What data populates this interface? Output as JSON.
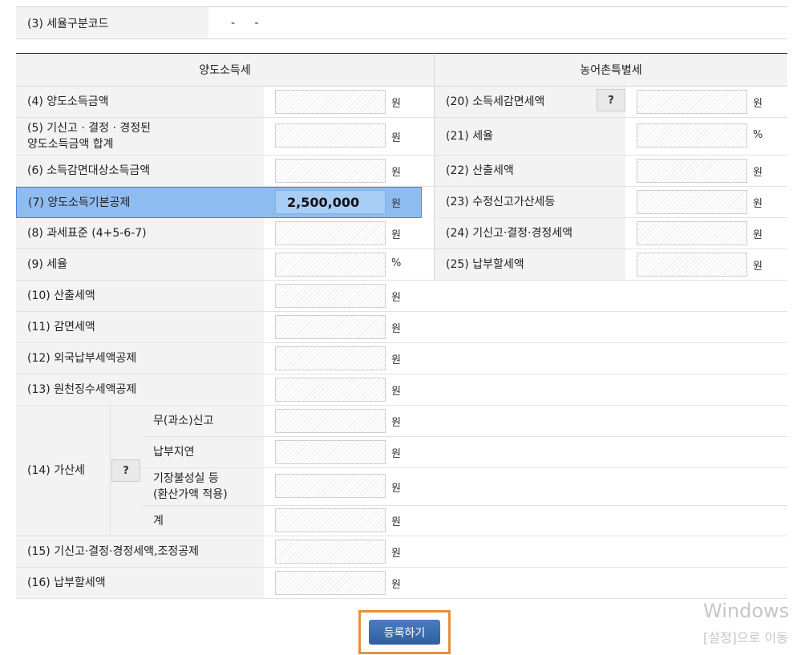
{
  "tax_code": {
    "label": "(3) 세율구분코드",
    "value": "- -"
  },
  "headers": {
    "left": "양도소득세",
    "right": "농어촌특별세"
  },
  "units": {
    "won": "원",
    "percent": "%"
  },
  "help_label": "?",
  "left_rows": [
    {
      "label": "(4) 양도소득금액",
      "value": ""
    },
    {
      "label": "(5) 기신고 · 결정 · 경정된\n양도소득금액 합계",
      "value": ""
    },
    {
      "label": "(6) 소득감면대상소득금액",
      "value": ""
    },
    {
      "label": "(7) 양도소득기본공제",
      "value": "2,500,000"
    },
    {
      "label": "(8) 과세표준 (4+5-6-7)",
      "value": ""
    },
    {
      "label": "(9) 세율",
      "value": ""
    },
    {
      "label": "(10) 산출세액",
      "value": ""
    },
    {
      "label": "(11) 감면세액",
      "value": ""
    },
    {
      "label": "(12) 외국납부세액공제",
      "value": ""
    },
    {
      "label": "(13) 원천징수세액공제",
      "value": ""
    }
  ],
  "penalty": {
    "label": "(14) 가산세",
    "sub_rows": [
      {
        "label": "무(과소)신고",
        "value": ""
      },
      {
        "label": "납부지연",
        "value": ""
      },
      {
        "label": "기장불성실 등\n(환산가액 적용)",
        "value": ""
      },
      {
        "label": "계",
        "value": ""
      }
    ]
  },
  "bottom_rows": [
    {
      "label": "(15) 기신고·결정·경정세액,조정공제",
      "value": ""
    },
    {
      "label": "(16) 납부할세액",
      "value": ""
    }
  ],
  "right_rows": [
    {
      "label": "(20) 소득세감면세액",
      "value": ""
    },
    {
      "label": "(21) 세율",
      "value": ""
    },
    {
      "label": "(22) 산출세액",
      "value": ""
    },
    {
      "label": "(23) 수정신고가산세등",
      "value": ""
    },
    {
      "label": "(24) 기신고·결정·경정세액",
      "value": ""
    },
    {
      "label": "(25) 납부할세액",
      "value": ""
    }
  ],
  "submit_label": "등록하기",
  "watermark": {
    "line1": "Windows",
    "line2": "[설정]으로 이동"
  }
}
